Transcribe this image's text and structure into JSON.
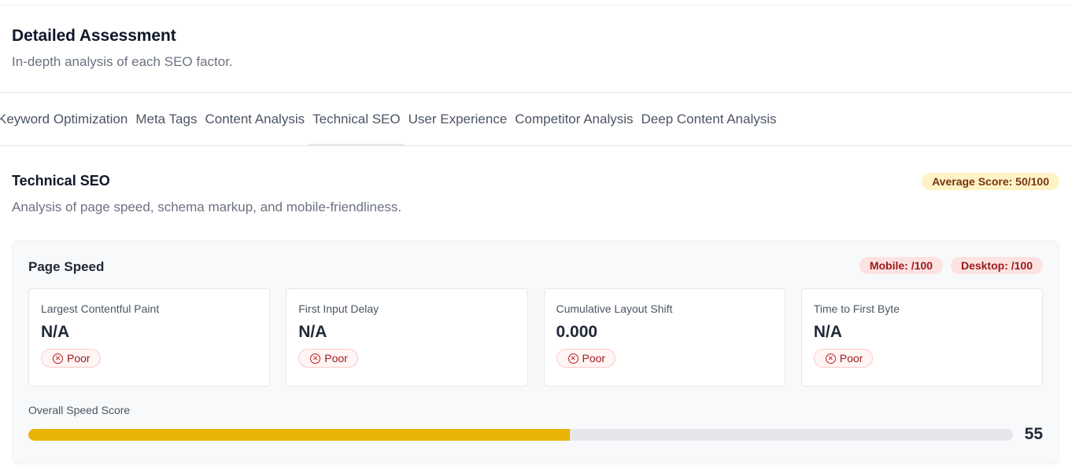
{
  "header": {
    "title": "Detailed Assessment",
    "subtitle": "In-depth analysis of each SEO factor."
  },
  "tabs": [
    {
      "label": "Keyword Optimization",
      "active": false
    },
    {
      "label": "Meta Tags",
      "active": false
    },
    {
      "label": "Content Analysis",
      "active": false
    },
    {
      "label": "Technical SEO",
      "active": true
    },
    {
      "label": "User Experience",
      "active": false
    },
    {
      "label": "Competitor Analysis",
      "active": false
    },
    {
      "label": "Deep Content Analysis",
      "active": false
    }
  ],
  "section": {
    "title": "Technical SEO",
    "description": "Analysis of page speed, schema markup, and mobile-friendliness.",
    "average_score": "Average Score: 50/100"
  },
  "page_speed": {
    "title": "Page Speed",
    "mobile": "Mobile: /100",
    "desktop": "Desktop: /100",
    "metrics": [
      {
        "label": "Largest Contentful Paint",
        "value": "N/A",
        "status": "Poor"
      },
      {
        "label": "First Input Delay",
        "value": "N/A",
        "status": "Poor"
      },
      {
        "label": "Cumulative Layout Shift",
        "value": "0.000",
        "status": "Poor"
      },
      {
        "label": "Time to First Byte",
        "value": "N/A",
        "status": "Poor"
      }
    ],
    "overall_label": "Overall Speed Score",
    "overall_value": "55",
    "overall_fraction": 0.55
  },
  "colors": {
    "progress_fill": "#eab308",
    "poor_badge": "#991b1b",
    "average_badge": "#fef3c7"
  },
  "icons": {
    "status": "x-circle-icon"
  }
}
